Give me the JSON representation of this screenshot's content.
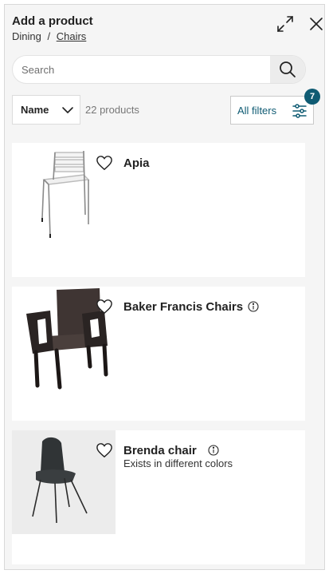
{
  "header": {
    "title": "Add a product",
    "breadcrumb": [
      {
        "label": "Dining"
      },
      {
        "label": "Chairs"
      }
    ],
    "breadcrumb_separator": "/"
  },
  "search": {
    "placeholder": "Search",
    "value": ""
  },
  "sort": {
    "selected": "Name"
  },
  "product_count": "22 products",
  "filters": {
    "label": "All filters",
    "badge_count": "7"
  },
  "products": [
    {
      "name": "Apia",
      "info": false,
      "subtitle": ""
    },
    {
      "name": "Baker Francis Chairs",
      "info": true,
      "subtitle": ""
    },
    {
      "name": "Brenda chair",
      "info": true,
      "subtitle": "Exists in different colors"
    }
  ],
  "colors": {
    "accent": "#0f5b73",
    "panel_bg": "#f5f5f5",
    "card_bg": "#ffffff"
  },
  "icons": [
    "expand-icon",
    "close-icon",
    "search-icon",
    "chevron-down-icon",
    "filter-sliders-icon",
    "heart-icon",
    "info-icon"
  ]
}
